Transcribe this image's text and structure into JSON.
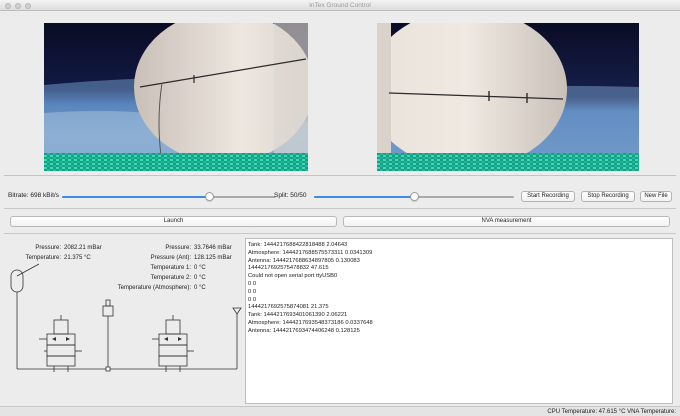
{
  "window": {
    "title": "InTex Ground Control"
  },
  "controls": {
    "bitrate_label": "Bitrate: 698 kBit/s",
    "bitrate_fraction": 0.69,
    "split_label": "Split: 50/50",
    "split_fraction": 0.5,
    "start_recording": "Start Recording",
    "stop_recording": "Stop Recording",
    "new_file": "New File"
  },
  "actions": {
    "launch": "Launch",
    "nva_measurement": "NVA measurement"
  },
  "telemetry": {
    "left": [
      {
        "label": "Pressure:",
        "value": "2082.21 mBar"
      },
      {
        "label": "Temperature:",
        "value": "21.375 °C"
      }
    ],
    "right": [
      {
        "label": "Pressure:",
        "value": "33.7646 mBar"
      },
      {
        "label": "Pressure (Ant):",
        "value": "128.125 mBar"
      },
      {
        "label": "Temperature 1:",
        "value": "0 °C"
      },
      {
        "label": "Temperature 2:",
        "value": "0 °C"
      },
      {
        "label": "Temperature (Atmosphere):",
        "value": "0 °C"
      }
    ]
  },
  "log": [
    "Tank: 1444217688422818488 2.04643",
    "Atmosphere: 1444217688575573311 0.0341309",
    "Antenna: 1444217688634897805 0.130083",
    "1444217692575478832 47.615",
    "Could not open serial port ttyUSB0",
    "0 0",
    "0 0",
    "0 0",
    "1444217692575874081 21.375",
    "Tank: 1444217693401061390 2.06221",
    "Atmosphere: 1444217693548373186 0.0337648",
    "Antenna: 1444217693474406248 0.128125"
  ],
  "status": {
    "text": "CPU Temperature:  47.615 °C  VNA Temperature:"
  },
  "colors": {
    "accent": "#3d8ce8",
    "space": "#0b0e2a",
    "noise": "#29c8a0"
  }
}
